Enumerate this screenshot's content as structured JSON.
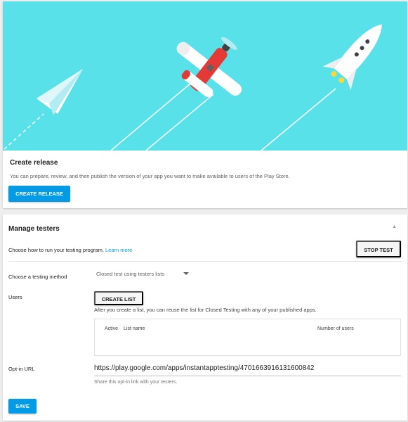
{
  "colors": {
    "hero_sky": "#59e1ea",
    "accent": "#039be5",
    "plane_red": "#e53935"
  },
  "release": {
    "title": "Create release",
    "description": "You can prepare, review, and then publish the version of your app you want to make available to users of the Play Store.",
    "button": "CREATE RELEASE"
  },
  "testers": {
    "title": "Manage testers",
    "collapse_icon": "chevron-up-icon",
    "run_text": "Choose how to run your testing program. ",
    "learn_more": "Learn more",
    "stop_button": "STOP TEST",
    "method_label": "Choose a testing method",
    "method_value": "Closed test using testers lists",
    "users_label": "Users",
    "create_list_button": "CREATE LIST",
    "list_hint": "After you create a list, you can reuse the list for Closed Testing with any of your published apps.",
    "columns": {
      "active": "Active",
      "list_name": "List name",
      "number_of_users": "Number of users"
    },
    "optin_label": "Opt-in URL",
    "optin_url": "https://play.google.com/apps/instantapptesting/4701663916131600842",
    "optin_hint": "Share this opt-in link with your testers.",
    "save_button": "SAVE"
  }
}
